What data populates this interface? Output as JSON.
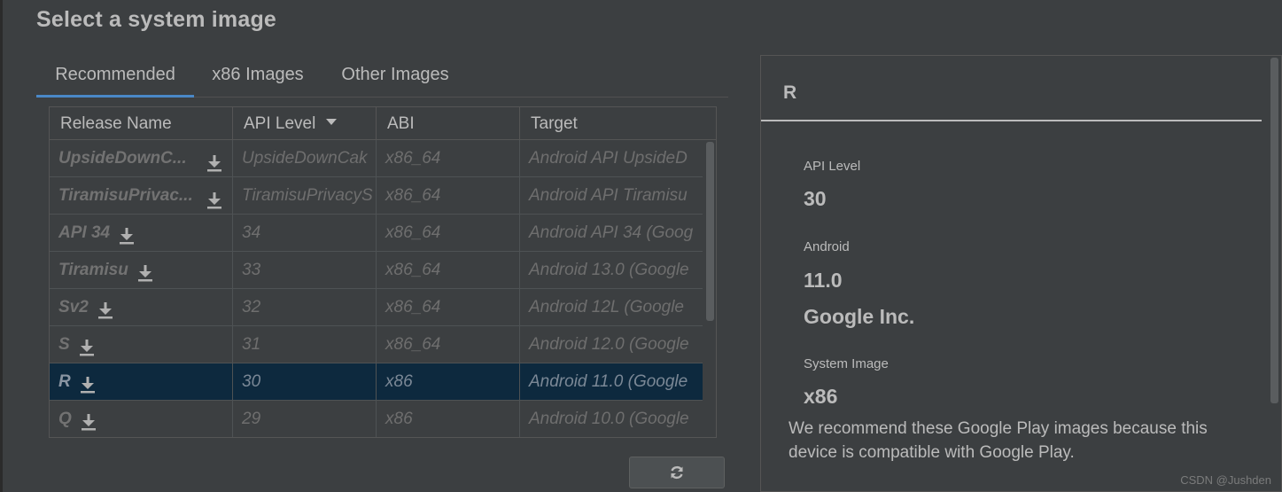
{
  "dialog": {
    "title": "Select a system image"
  },
  "tabs": [
    {
      "label": "Recommended",
      "active": true
    },
    {
      "label": "x86 Images",
      "active": false
    },
    {
      "label": "Other Images",
      "active": false
    }
  ],
  "table": {
    "columns": [
      {
        "label": "Release Name"
      },
      {
        "label": "API Level",
        "sorted": "descending"
      },
      {
        "label": "ABI"
      },
      {
        "label": "Target"
      }
    ],
    "rows": [
      {
        "name": "UpsideDownC...",
        "api": "UpsideDownCak",
        "abi": "x86_64",
        "target": "Android API UpsideD",
        "download_icon": "download-icon",
        "selected": false
      },
      {
        "name": "TiramisuPrivac...",
        "api": "TiramisuPrivacyS",
        "abi": "x86_64",
        "target": "Android API Tiramisu",
        "download_icon": "download-icon",
        "selected": false
      },
      {
        "name": "API 34",
        "api": "34",
        "abi": "x86_64",
        "target": "Android API 34 (Goog",
        "download_icon": "download-icon",
        "selected": false
      },
      {
        "name": "Tiramisu",
        "api": "33",
        "abi": "x86_64",
        "target": "Android 13.0 (Google",
        "download_icon": "download-icon",
        "selected": false
      },
      {
        "name": "Sv2",
        "api": "32",
        "abi": "x86_64",
        "target": "Android 12L (Google",
        "download_icon": "download-icon",
        "selected": false
      },
      {
        "name": "S",
        "api": "31",
        "abi": "x86_64",
        "target": "Android 12.0 (Google",
        "download_icon": "download-icon",
        "selected": false
      },
      {
        "name": "R",
        "api": "30",
        "abi": "x86",
        "target": "Android 11.0 (Google",
        "download_icon": "download-icon",
        "selected": true
      },
      {
        "name": "Q",
        "api": "29",
        "abi": "x86",
        "target": "Android 10.0 (Google",
        "download_icon": "download-icon",
        "selected": false
      }
    ]
  },
  "refresh_button": {
    "icon": "refresh-icon"
  },
  "details": {
    "title": "R",
    "api_level_label": "API Level",
    "api_level_value": "30",
    "android_label": "Android",
    "android_value": "11.0",
    "vendor": "Google Inc.",
    "system_image_label": "System Image",
    "system_image_value": "x86",
    "description": "We recommend these Google Play images because this device is compatible with Google Play."
  },
  "watermark": "CSDN @Jushden",
  "colors": {
    "background": "#3c3f41",
    "tab_active_underline": "#4a88c7",
    "selected_row": "#0d293e",
    "text": "#bbbbbb",
    "disabled_text": "#6e6e6e"
  }
}
